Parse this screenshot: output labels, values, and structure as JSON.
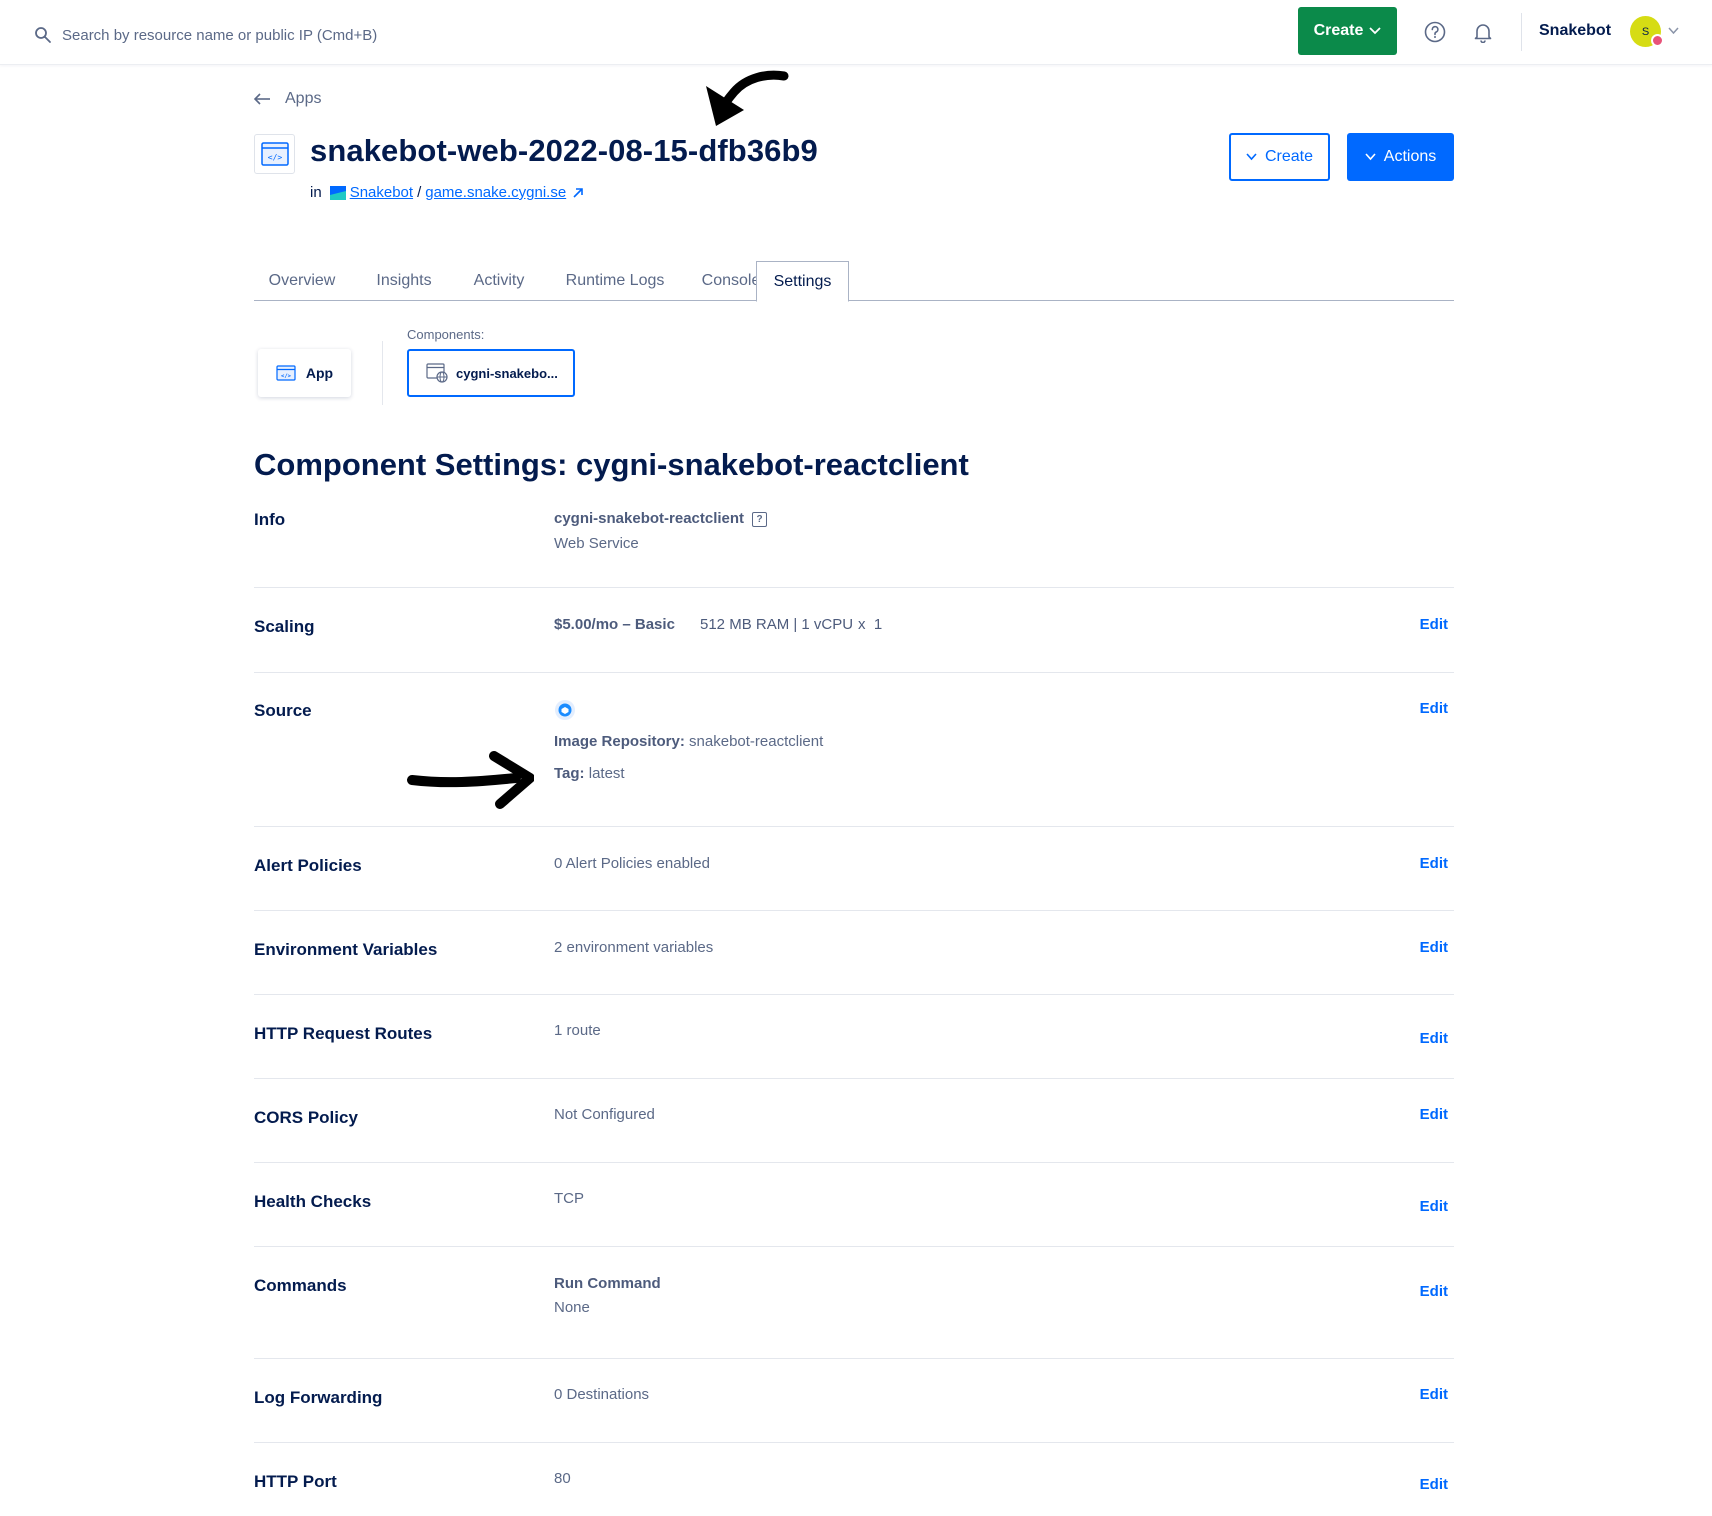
{
  "topbar": {
    "search_placeholder": "Search by resource name or public IP (Cmd+B)",
    "create_label": "Create",
    "team_name": "Snakebot",
    "avatar_initial": "S"
  },
  "header": {
    "back_label": "Apps",
    "title": "snakebot-web-2022-08-15-dfb36b9",
    "in_label": "in",
    "project_link": "Snakebot",
    "separator": "/",
    "domain_link": "game.snake.cygni.se",
    "create_button": "Create",
    "actions_button": "Actions"
  },
  "tabs": [
    {
      "label": "Overview"
    },
    {
      "label": "Insights"
    },
    {
      "label": "Activity"
    },
    {
      "label": "Runtime Logs"
    },
    {
      "label": "Console"
    },
    {
      "label": "Settings"
    }
  ],
  "components": {
    "label": "Components:",
    "app_card": "App",
    "component_card": "cygni-snakebo..."
  },
  "settings": {
    "title": "Component Settings: cygni-snakebot-reactclient",
    "edit_label": "Edit",
    "info": {
      "label": "Info",
      "name": "cygni-snakebot-reactclient",
      "help": "?",
      "type": "Web Service"
    },
    "scaling": {
      "label": "Scaling",
      "plan": "$5.00/mo – Basic",
      "spec": "512 MB RAM | 1 vCPU",
      "count": "x  1"
    },
    "source": {
      "label": "Source",
      "repo_key": "Image Repository:",
      "repo_value": "snakebot-reactclient",
      "tag_key": "Tag:",
      "tag_value": "latest"
    },
    "alert_policies": {
      "label": "Alert Policies",
      "value": "0 Alert Policies enabled"
    },
    "env_vars": {
      "label": "Environment Variables",
      "value": "2 environment variables"
    },
    "http_routes": {
      "label": "HTTP Request Routes",
      "value": "1 route"
    },
    "cors": {
      "label": "CORS Policy",
      "value": "Not Configured"
    },
    "health": {
      "label": "Health Checks",
      "value": "TCP"
    },
    "commands": {
      "label": "Commands",
      "key": "Run Command",
      "value": "None"
    },
    "log_forwarding": {
      "label": "Log Forwarding",
      "value": "0 Destinations"
    },
    "http_port": {
      "label": "HTTP Port",
      "value": "80"
    }
  },
  "colors": {
    "primary": "#0069ff",
    "create_green": "#0b8a4a",
    "text_dark": "#031b4e",
    "text_muted": "#5b6987"
  }
}
